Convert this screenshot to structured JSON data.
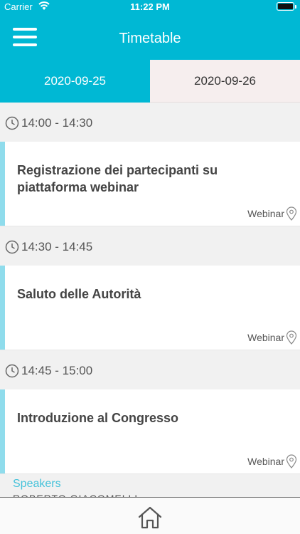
{
  "status_bar": {
    "carrier": "Carrier",
    "time": "11:22 PM"
  },
  "header": {
    "title": "Timetable"
  },
  "tabs": [
    {
      "label": "2020-09-25",
      "active": true
    },
    {
      "label": "2020-09-26",
      "active": false
    }
  ],
  "slots": [
    {
      "time": "14:00 - 14:30",
      "title": "Registrazione dei partecipanti su piattaforma webinar",
      "location": "Webinar"
    },
    {
      "time": "14:30 - 14:45",
      "title": "Saluto delle Autorità",
      "location": "Webinar"
    },
    {
      "time": "14:45 - 15:00",
      "title": "Introduzione al Congresso",
      "location": "Webinar"
    }
  ],
  "speakers": {
    "label": "Speakers",
    "first_speaker": "ROBERTO GIACOMELLI"
  },
  "colors": {
    "primary": "#00b8d4",
    "accent_bar": "#8fdcec",
    "inactive_tab": "#f6eeee",
    "link": "#45c2da"
  },
  "icons": {
    "menu": "hamburger-menu-icon",
    "clock": "clock-icon",
    "location": "map-pin-icon",
    "home": "home-icon"
  }
}
